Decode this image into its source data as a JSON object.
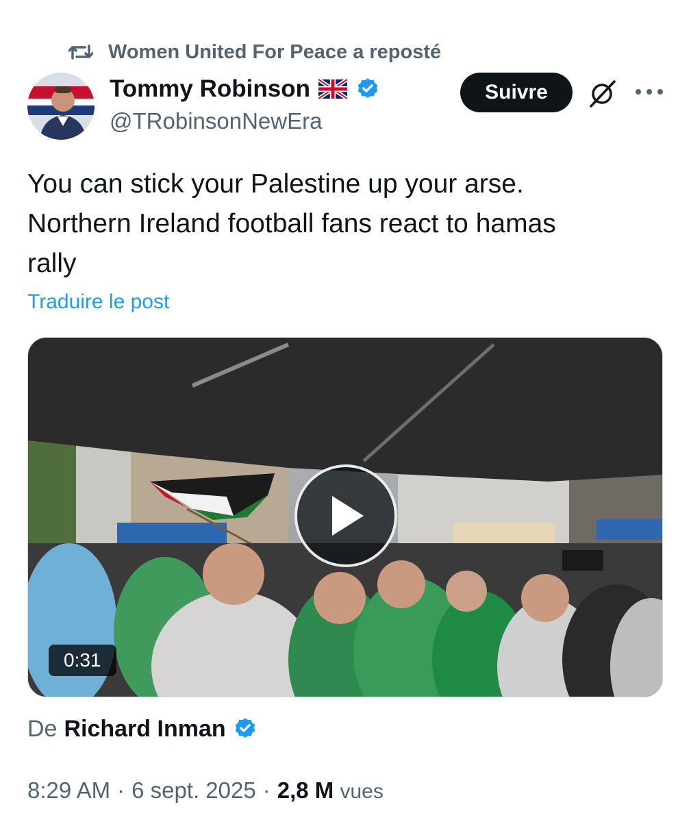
{
  "repost": {
    "label": "Women United For Peace a reposté",
    "icon": "repost-icon"
  },
  "author": {
    "name": "Tommy Robinson",
    "flag": "🇬🇧",
    "verified": true,
    "handle": "@TRobinsonNewEra"
  },
  "actions": {
    "follow_label": "Suivre",
    "grok_icon": "grok-icon",
    "more_icon": "more-icon"
  },
  "post": {
    "text_lines": [
      "You can stick your Palestine up your arse.",
      "Northern Ireland football fans react to hamas",
      "rally"
    ],
    "translate_label": "Traduire le post"
  },
  "media": {
    "duration": "0:31",
    "play_icon": "play-icon"
  },
  "source": {
    "prefix": "De",
    "name": "Richard Inman",
    "verified": true
  },
  "meta": {
    "time": "8:29 AM",
    "separator": "·",
    "date": "6 sept. 2025",
    "views_count": "2,8 M",
    "views_label": "vues"
  },
  "colors": {
    "accent": "#1d9bf0",
    "text": "#0f1419",
    "secondary": "#536471",
    "button_bg": "#0f1419"
  }
}
